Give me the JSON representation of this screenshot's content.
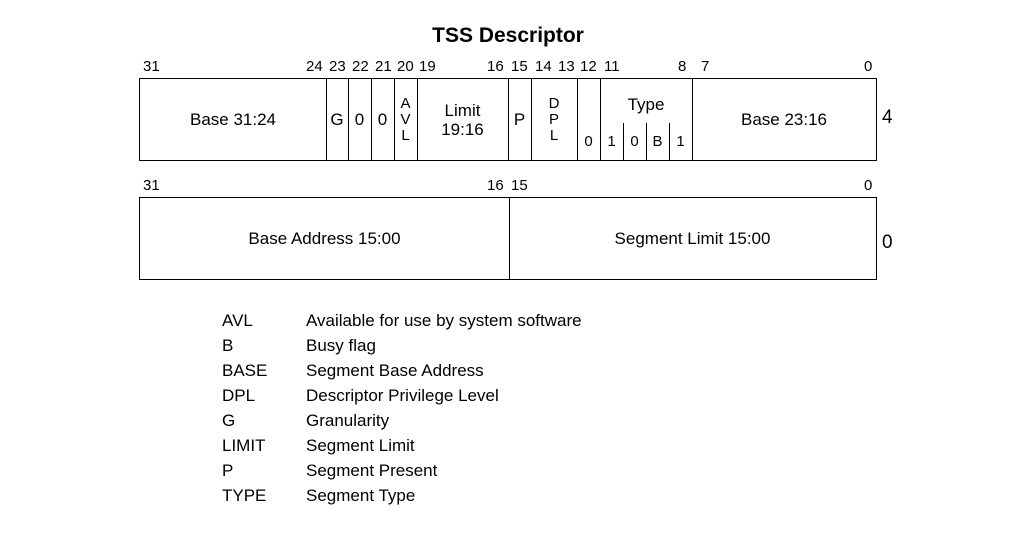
{
  "title": "TSS Descriptor",
  "row_high": {
    "offset_label": "4",
    "bit_numbers": [
      "31",
      "24",
      "23",
      "22",
      "21",
      "20",
      "19",
      "16",
      "15",
      "14",
      "13",
      "12",
      "11",
      "8",
      "7",
      "0"
    ],
    "fields": {
      "base_31_24": "Base 31:24",
      "g": "G",
      "zero_22": "0",
      "zero_21": "0",
      "avl": [
        "A",
        "V",
        "L"
      ],
      "limit_19_16": [
        "Limit",
        "19:16"
      ],
      "p": "P",
      "dpl": [
        "D",
        "P",
        "L"
      ],
      "zero_12": "0",
      "type_label": "Type",
      "type_bits": [
        "1",
        "0",
        "B",
        "1"
      ],
      "base_23_16": "Base 23:16"
    }
  },
  "row_low": {
    "offset_label": "0",
    "bit_numbers": [
      "31",
      "16",
      "15",
      "0"
    ],
    "fields": {
      "base_15_00": "Base Address 15:00",
      "limit_15_00": "Segment Limit 15:00"
    }
  },
  "legend": [
    {
      "abbr": "AVL",
      "desc": "Available for use by system software"
    },
    {
      "abbr": "B",
      "desc": "Busy flag"
    },
    {
      "abbr": "BASE",
      "desc": "Segment Base Address"
    },
    {
      "abbr": "DPL",
      "desc": "Descriptor Privilege Level"
    },
    {
      "abbr": "G",
      "desc": "Granularity"
    },
    {
      "abbr": "LIMIT",
      "desc": "Segment Limit"
    },
    {
      "abbr": "P",
      "desc": "Segment Present"
    },
    {
      "abbr": "TYPE",
      "desc": "Segment Type"
    }
  ]
}
